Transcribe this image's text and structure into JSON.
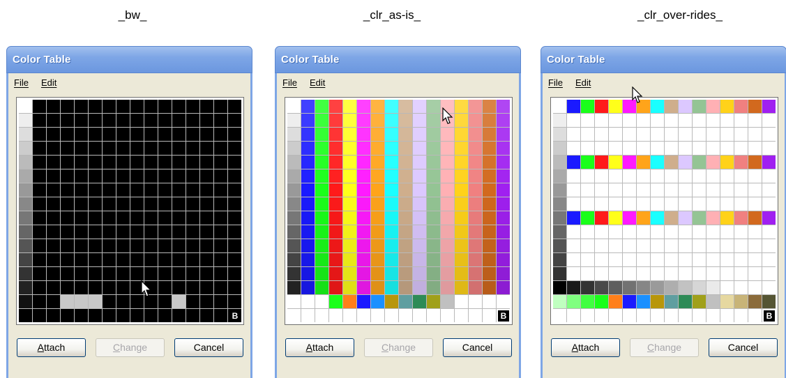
{
  "captions": [
    "_bw_",
    "_clr_as-is_",
    "_clr_over-rides_"
  ],
  "dialogs": [
    {
      "title": "Color Table",
      "menu": [
        "File",
        "Edit"
      ],
      "buttons": [
        "Attach",
        "Change",
        "Cancel"
      ],
      "badge": "B",
      "variant": "bw"
    },
    {
      "title": "Color Table",
      "menu": [
        "File",
        "Edit"
      ],
      "buttons": [
        "Attach",
        "Change",
        "Cancel"
      ],
      "badge": "B",
      "variant": "asis"
    },
    {
      "title": "Color Table",
      "menu": [
        "File",
        "Edit"
      ],
      "buttons": [
        "Attach",
        "Change",
        "Cancel"
      ],
      "badge": "B",
      "variant": "overrides"
    }
  ],
  "palette": {
    "column_colors": [
      "#1a1aff",
      "#1aff1a",
      "#ff1a1a",
      "#ffff1a",
      "#ff1aff",
      "#ffa41a",
      "#1affff",
      "#cfae8c",
      "#dcc8ff",
      "#94c494",
      "#ffb0b4",
      "#ffd21a",
      "#f08080",
      "#d2691e",
      "#a020f0"
    ],
    "gray_ramp": [
      "#ffffff",
      "#eeeeee",
      "#dddddd",
      "#cccccc",
      "#bbbbbb",
      "#aaaaaa",
      "#999999",
      "#888888",
      "#777777",
      "#666666",
      "#555555",
      "#444444",
      "#333333",
      "#222222",
      "#111111",
      "#000000"
    ],
    "extra_row_asis": [
      "#ffffff",
      "#ffffff",
      "#ffffff",
      "#1aff1a",
      "#ff7f1a",
      "#1a1aff",
      "#1a90ff",
      "#b8960b",
      "#5f9ea0",
      "#2e8b57",
      "#a0a01a",
      "#c0c0c0",
      "#ffffff",
      "#ffffff",
      "#ffffff",
      "#ffffff"
    ],
    "bottom_row_overrides": [
      "#c0ffc0",
      "#80ff80",
      "#40ff40",
      "#1aff1a",
      "#ff7f1a",
      "#1a1aff",
      "#1a90ff",
      "#b8960b",
      "#5f9ea0",
      "#2e8b57",
      "#a0a01a",
      "#c0c0c0",
      "#e6d8a0",
      "#c8b478",
      "#8b6b3a",
      "#555533"
    ],
    "dark_row_overrides": [
      "#000000",
      "#1a1a1a",
      "#333333",
      "#4a4a4a",
      "#5e5e5e",
      "#727272",
      "#868686",
      "#9a9a9a",
      "#aeaeae",
      "#c2c2c2",
      "#d6d6d6",
      "#eaeaea",
      "#ffffff",
      "#ffffff",
      "#ffffff",
      "#ffffff"
    ]
  }
}
